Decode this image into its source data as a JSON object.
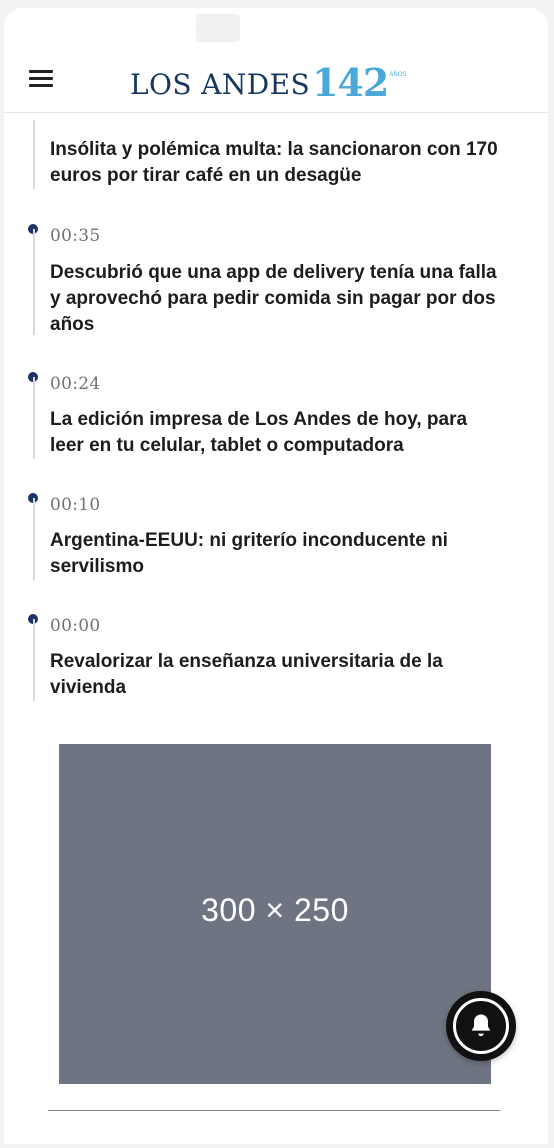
{
  "header": {
    "brand": "LOS ANDES",
    "brand_number": "142",
    "brand_years": "AÑOS"
  },
  "feed": {
    "items": [
      {
        "time": "",
        "headline": "Insólita y polémica multa: la sancionaron con 170 euros por tirar café en un desagüe"
      },
      {
        "time": "00:35",
        "headline": "Descubrió que una app de delivery tenía una falla y aprovechó para pedir comida sin pagar por dos años"
      },
      {
        "time": "00:24",
        "headline": "La edición impresa de Los Andes de hoy, para leer en tu celular, tablet o computadora"
      },
      {
        "time": "00:10",
        "headline": "Argentina-EEUU: ni griterío inconducente ni servilismo"
      },
      {
        "time": "00:00",
        "headline": "Revalorizar la enseñanza universitaria de la vivienda"
      }
    ]
  },
  "ad": {
    "label": "300 × 250"
  },
  "icons": {
    "menu": "hamburger-icon",
    "bell": "bell-icon"
  },
  "colors": {
    "timeline_dot": "#1d3365",
    "ad_background": "#6f7482",
    "brand_blue": "#17375f",
    "brand_accent": "#4aa8dd"
  }
}
